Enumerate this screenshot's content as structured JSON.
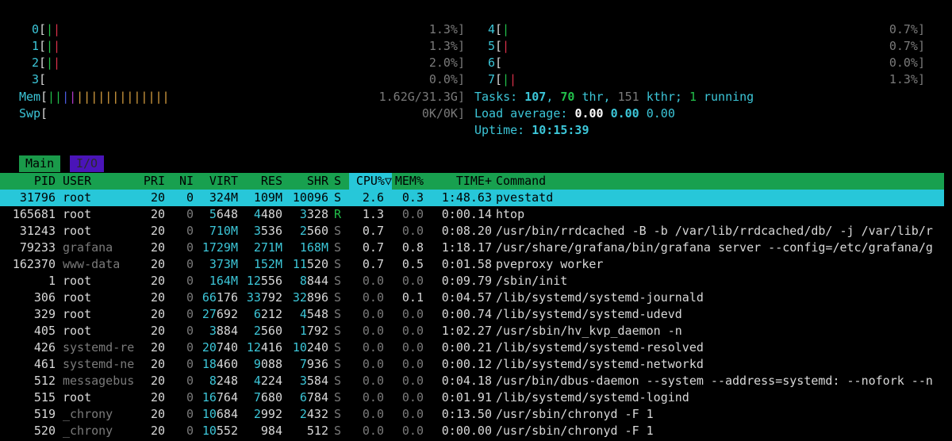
{
  "cpus": [
    {
      "id": "0",
      "bars": [
        [
          "g",
          "|"
        ],
        [
          "red",
          "|"
        ]
      ],
      "pct": "1.3%]"
    },
    {
      "id": "1",
      "bars": [
        [
          "g",
          "|"
        ],
        [
          "red",
          "|"
        ]
      ],
      "pct": "1.3%]"
    },
    {
      "id": "2",
      "bars": [
        [
          "g",
          "|"
        ],
        [
          "red",
          "|"
        ]
      ],
      "pct": "2.0%]"
    },
    {
      "id": "3",
      "bars": [],
      "pct": "0.0%]"
    },
    {
      "id": "4",
      "bars": [
        [
          "g",
          "|"
        ]
      ],
      "pct": "0.7%]"
    },
    {
      "id": "5",
      "bars": [
        [
          "red",
          "|"
        ]
      ],
      "pct": "0.7%]"
    },
    {
      "id": "6",
      "bars": [],
      "pct": "0.0%]"
    },
    {
      "id": "7",
      "bars": [
        [
          "g",
          "|"
        ],
        [
          "red",
          "|"
        ]
      ],
      "pct": "1.3%]"
    }
  ],
  "mem": {
    "label": "Mem",
    "bars": [
      [
        "g",
        "|"
      ],
      [
        "g",
        "|"
      ],
      [
        "blu",
        "|"
      ],
      [
        "mag",
        "|"
      ],
      [
        "org",
        "|"
      ],
      [
        "org",
        "|"
      ],
      [
        "org",
        "|"
      ],
      [
        "org",
        "|"
      ],
      [
        "org",
        "|"
      ],
      [
        "org",
        "|"
      ],
      [
        "org",
        "|"
      ],
      [
        "org",
        "|"
      ],
      [
        "org",
        "|"
      ],
      [
        "org",
        "|"
      ],
      [
        "org",
        "|"
      ],
      [
        "org",
        "|"
      ],
      [
        "org",
        "|"
      ]
    ],
    "value": "1.62G/31.3G]"
  },
  "swap": {
    "label": "Swp",
    "value": "0K/0K]"
  },
  "tasks": {
    "label": "Tasks:",
    "count": "107",
    "sep1": ",",
    "thr": "70",
    "thr_label": "thr,",
    "kthr": "151",
    "kthr_label": "kthr;",
    "running": "1",
    "running_label": "running"
  },
  "load": {
    "label": "Load average:",
    "v1": "0.00",
    "v2": "0.00",
    "v3": "0.00"
  },
  "uptime": {
    "label": "Uptime:",
    "value": "10:15:39"
  },
  "tabs": {
    "main": "Main",
    "io": "I/O"
  },
  "columns": {
    "pid": "PID",
    "user": "USER",
    "pri": "PRI",
    "ni": "NI",
    "virt": "VIRT",
    "res": "RES",
    "shr": "SHR",
    "s": "S",
    "cpu": "CPU%▽",
    "mem": "MEM%",
    "time": "TIME+",
    "command": "Command"
  },
  "processes": [
    {
      "pid": "31796",
      "user": "root",
      "pri": "20",
      "ni": "0",
      "virt": "324M",
      "res": "109M",
      "shr": "10096",
      "s": "S",
      "cpu": "2.6",
      "mem": "0.3",
      "time": "1:48.63",
      "cmd": "pvestatd"
    },
    {
      "pid": "165681",
      "user": "root",
      "pri": "20",
      "ni": "0",
      "virt": "5648",
      "res": "4480",
      "shr": "3328",
      "s": "R",
      "cpu": "1.3",
      "mem": "0.0",
      "time": "0:00.14",
      "cmd": "htop"
    },
    {
      "pid": "31243",
      "user": "root",
      "pri": "20",
      "ni": "0",
      "virt": "710M",
      "res": "3536",
      "shr": "2560",
      "s": "S",
      "cpu": "0.7",
      "mem": "0.0",
      "time": "0:08.20",
      "cmd": "/usr/bin/rrdcached -B -b /var/lib/rrdcached/db/ -j /var/lib/r"
    },
    {
      "pid": "79233",
      "user": "grafana",
      "pri": "20",
      "ni": "0",
      "virt": "1729M",
      "res": "271M",
      "shr": "168M",
      "s": "S",
      "cpu": "0.7",
      "mem": "0.8",
      "time": "1:18.17",
      "cmd": "/usr/share/grafana/bin/grafana server --config=/etc/grafana/g"
    },
    {
      "pid": "162370",
      "user": "www-data",
      "pri": "20",
      "ni": "0",
      "virt": "373M",
      "res": "152M",
      "shr": "11520",
      "s": "S",
      "cpu": "0.7",
      "mem": "0.5",
      "time": "0:01.58",
      "cmd": "pveproxy worker"
    },
    {
      "pid": "1",
      "user": "root",
      "pri": "20",
      "ni": "0",
      "virt": "164M",
      "res": "12556",
      "shr": "8844",
      "s": "S",
      "cpu": "0.0",
      "mem": "0.0",
      "time": "0:09.79",
      "cmd": "/sbin/init"
    },
    {
      "pid": "306",
      "user": "root",
      "pri": "20",
      "ni": "0",
      "virt": "66176",
      "res": "33792",
      "shr": "32896",
      "s": "S",
      "cpu": "0.0",
      "mem": "0.1",
      "time": "0:04.57",
      "cmd": "/lib/systemd/systemd-journald"
    },
    {
      "pid": "329",
      "user": "root",
      "pri": "20",
      "ni": "0",
      "virt": "27692",
      "res": "6212",
      "shr": "4548",
      "s": "S",
      "cpu": "0.0",
      "mem": "0.0",
      "time": "0:00.74",
      "cmd": "/lib/systemd/systemd-udevd"
    },
    {
      "pid": "405",
      "user": "root",
      "pri": "20",
      "ni": "0",
      "virt": "3884",
      "res": "2560",
      "shr": "1792",
      "s": "S",
      "cpu": "0.0",
      "mem": "0.0",
      "time": "1:02.27",
      "cmd": "/usr/sbin/hv_kvp_daemon -n"
    },
    {
      "pid": "426",
      "user": "systemd-re",
      "pri": "20",
      "ni": "0",
      "virt": "20740",
      "res": "12416",
      "shr": "10240",
      "s": "S",
      "cpu": "0.0",
      "mem": "0.0",
      "time": "0:00.21",
      "cmd": "/lib/systemd/systemd-resolved"
    },
    {
      "pid": "461",
      "user": "systemd-ne",
      "pri": "20",
      "ni": "0",
      "virt": "18460",
      "res": "9088",
      "shr": "7936",
      "s": "S",
      "cpu": "0.0",
      "mem": "0.0",
      "time": "0:00.12",
      "cmd": "/lib/systemd/systemd-networkd"
    },
    {
      "pid": "512",
      "user": "messagebus",
      "pri": "20",
      "ni": "0",
      "virt": "8248",
      "res": "4224",
      "shr": "3584",
      "s": "S",
      "cpu": "0.0",
      "mem": "0.0",
      "time": "0:04.18",
      "cmd": "/usr/bin/dbus-daemon --system --address=systemd: --nofork --n"
    },
    {
      "pid": "515",
      "user": "root",
      "pri": "20",
      "ni": "0",
      "virt": "16764",
      "res": "7680",
      "shr": "6784",
      "s": "S",
      "cpu": "0.0",
      "mem": "0.0",
      "time": "0:01.91",
      "cmd": "/lib/systemd/systemd-logind"
    },
    {
      "pid": "519",
      "user": "_chrony",
      "pri": "20",
      "ni": "0",
      "virt": "10684",
      "res": "2992",
      "shr": "2432",
      "s": "S",
      "cpu": "0.0",
      "mem": "0.0",
      "time": "0:13.50",
      "cmd": "/usr/sbin/chronyd -F 1"
    },
    {
      "pid": "520",
      "user": "_chrony",
      "pri": "20",
      "ni": "0",
      "virt": "10552",
      "res": "984",
      "shr": "512",
      "s": "S",
      "cpu": "0.0",
      "mem": "0.0",
      "time": "0:00.00",
      "cmd": "/usr/sbin/chronyd -F 1"
    }
  ]
}
